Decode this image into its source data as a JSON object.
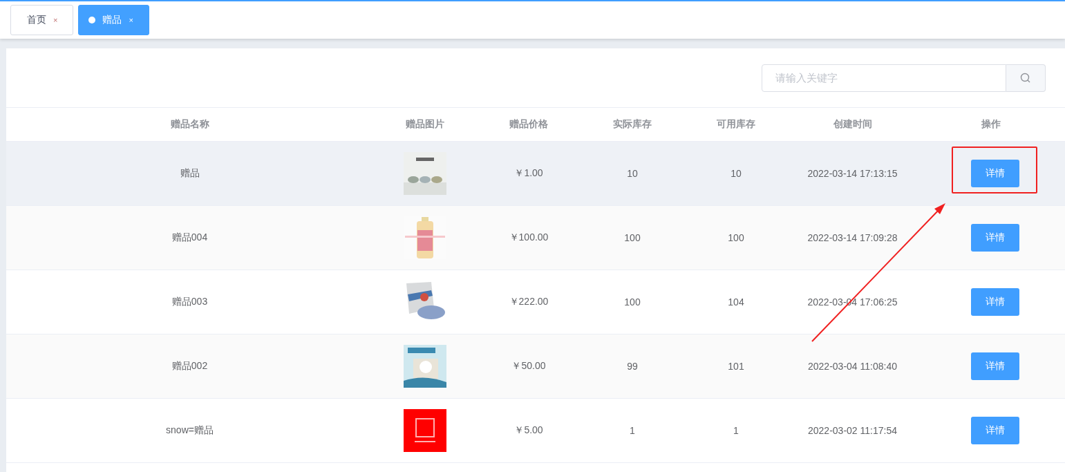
{
  "tabs": [
    {
      "label": "首页",
      "close": "×",
      "selected": false
    },
    {
      "label": "赠品",
      "close": "×",
      "selected": true
    }
  ],
  "search": {
    "placeholder": "请输入关键字"
  },
  "table": {
    "columns": [
      "赠品名称",
      "赠品图片",
      "赠品价格",
      "实际库存",
      "可用库存",
      "创建时间",
      "操作"
    ],
    "rows": [
      {
        "name": "赠品",
        "price": "￥1.00",
        "stock": "10",
        "available": "10",
        "created": "2022-03-14 17:13:15",
        "action": "详情",
        "hovered": true,
        "annotated": true
      },
      {
        "name": "赠品004",
        "price": "￥100.00",
        "stock": "100",
        "available": "100",
        "created": "2022-03-14 17:09:28",
        "action": "详情",
        "hovered": false,
        "annotated": false
      },
      {
        "name": "赠品003",
        "price": "￥222.00",
        "stock": "100",
        "available": "104",
        "created": "2022-03-04 17:06:25",
        "action": "详情",
        "hovered": false,
        "annotated": false
      },
      {
        "name": "赠品002",
        "price": "￥50.00",
        "stock": "99",
        "available": "101",
        "created": "2022-03-04 11:08:40",
        "action": "详情",
        "hovered": false,
        "annotated": false
      },
      {
        "name": "snow=赠品",
        "price": "￥5.00",
        "stock": "1",
        "available": "1",
        "created": "2022-03-02 11:17:54",
        "action": "详情",
        "hovered": false,
        "annotated": false
      }
    ]
  }
}
